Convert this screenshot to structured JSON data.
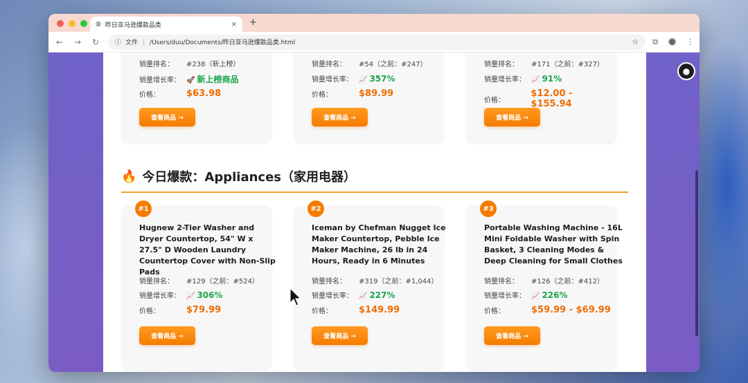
{
  "browser": {
    "tab_title": "昨日亚马逊爆款品类",
    "tab_close": "×",
    "new_tab": "+",
    "address_scheme": "文件",
    "address_url": "/Users/duu/Documents/昨日亚马逊爆款品类.html",
    "nav": {
      "back": "←",
      "forward": "→",
      "reload": "↻"
    },
    "star": "☆"
  },
  "labels": {
    "rank": "销量排名：",
    "growth": "销量增长率：",
    "price": "价格："
  },
  "top_cards": [
    {
      "rank": "#238（新上榜）",
      "growth_icon": "🚀",
      "growth": "新上榜商品",
      "price": "$63.98",
      "button": "查看商品 →"
    },
    {
      "rank": "#54（之前：#247）",
      "growth_icon": "📈",
      "growth": "357%",
      "price": "$89.99",
      "button": "查看商品 →"
    },
    {
      "rank": "#171（之前：#327）",
      "growth_icon": "📈",
      "growth": "91%",
      "price": "$12.00 - $155.94",
      "button": "查看商品 →"
    }
  ],
  "section": {
    "icon": "🔥",
    "title": "今日爆款：Appliances（家用电器）"
  },
  "appliance_cards": [
    {
      "badge": "#1",
      "title": "Hugnew 2-Tier Washer and Dryer Countertop, 54\" W x 27.5\" D Wooden Laundry Countertop Cover with Non-Slip Pads",
      "rank": "#129（之前：#524）",
      "growth_icon": "📈",
      "growth": "306%",
      "price": "$79.99",
      "button": "查看商品 →"
    },
    {
      "badge": "#2",
      "title": "Iceman by Chefman Nugget Ice Maker Countertop, Pebble Ice Maker Machine, 26 lb in 24 Hours, Ready in 6 Minutes",
      "rank": "#319（之前：#1,044）",
      "growth_icon": "📈",
      "growth": "227%",
      "price": "$149.99",
      "button": "查看商品 →"
    },
    {
      "badge": "#3",
      "title": "Portable Washing Machine - 16L Mini Foldable Washer with Spin Basket, 3 Cleaning Modes & Deep Cleaning for Small Clothes",
      "rank": "#126（之前：#412）",
      "growth_icon": "📈",
      "growth": "226%",
      "price": "$59.99 - $69.99",
      "button": "查看商品 →"
    }
  ],
  "colors": {
    "accent": "#f57c00",
    "growth_green": "#1aa64a",
    "page_bg": "#7a5cc4"
  }
}
